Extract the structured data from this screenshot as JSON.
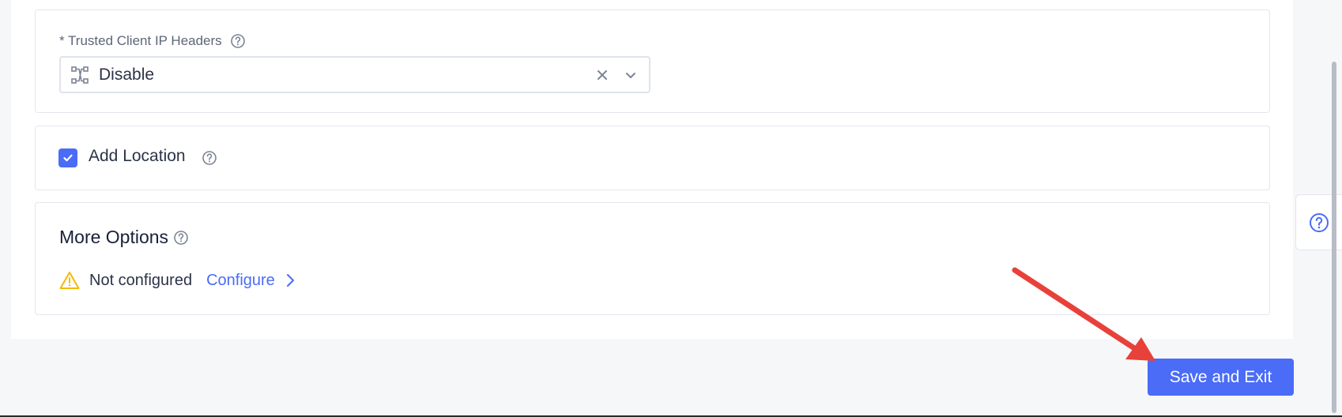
{
  "trusted_ip": {
    "label": "* Trusted Client IP Headers",
    "selected_value": "Disable",
    "icons": [
      "help-icon",
      "network-icon",
      "clear-icon",
      "chevron-down-icon"
    ]
  },
  "location": {
    "label": "Add Location",
    "checked": true
  },
  "more_options": {
    "title": "More Options",
    "status_text": "Not configured",
    "configure_link": "Configure"
  },
  "actions": {
    "save_exit_label": "Save and Exit"
  },
  "colors": {
    "accent": "#4a6cf7",
    "warning": "#f5b800",
    "annotation_arrow": "#e8413a"
  }
}
